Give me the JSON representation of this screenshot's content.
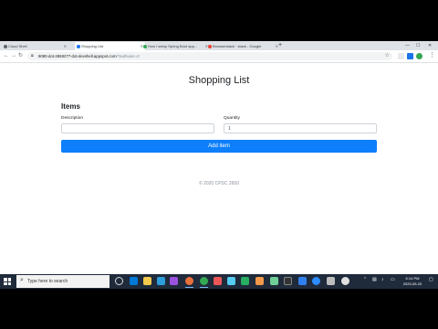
{
  "browser": {
    "tabs": [
      {
        "label": "Cloud Shell",
        "icon_color": "#5f6368"
      },
      {
        "label": "Shopping List",
        "icon_color": "#1a73e8"
      },
      {
        "label": "How I setup Spring Boot app...",
        "icon_color": "#34a853"
      },
      {
        "label": "Browserstack · stack - Google",
        "icon_color": "#ea4335"
      }
    ],
    "new_tab": "+",
    "url_host": "8080-dot-2869277-dot-devshell.appspot.com",
    "url_path": "/?authuser=0",
    "minimize": "—",
    "maximize": "☐",
    "close": "✕"
  },
  "page": {
    "title": "Shopping List",
    "section_title": "Items",
    "description_label": "Description",
    "description_value": "",
    "quantity_label": "Quantity",
    "quantity_value": "1",
    "add_button": "Add item",
    "footer": "© 2020 CPSC 2650"
  },
  "taskbar": {
    "search_placeholder": "Type here to search",
    "time": "5:14 PM",
    "date": "2020-05-20"
  },
  "colors": {
    "primary_button": "#0d7ffb",
    "taskbar": "#1f2a3b"
  }
}
